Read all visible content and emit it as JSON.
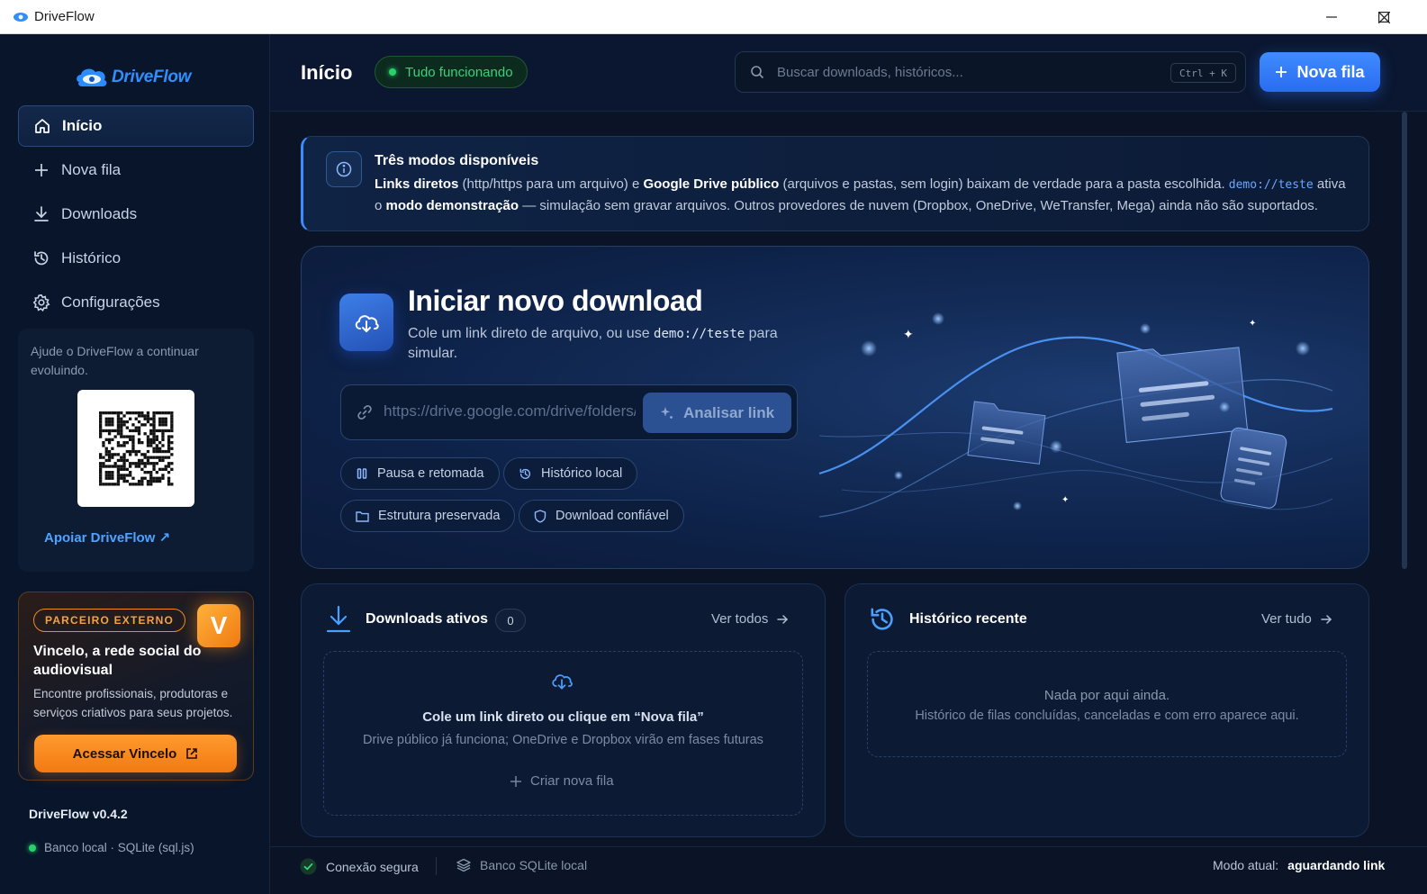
{
  "window": {
    "title": "DriveFlow"
  },
  "sidebar": {
    "logo_text": "DriveFlow",
    "nav": [
      {
        "label": "Início",
        "icon": "home-icon",
        "active": true
      },
      {
        "label": "Nova fila",
        "icon": "plus-icon"
      },
      {
        "label": "Downloads",
        "icon": "download-icon"
      },
      {
        "label": "Histórico",
        "icon": "history-icon"
      },
      {
        "label": "Configurações",
        "icon": "gear-icon"
      }
    ],
    "support": {
      "text": "Ajude o DriveFlow a continuar evoluindo.",
      "link": "Apoiar DriveFlow ↗"
    },
    "partner": {
      "badge": "PARCEIRO EXTERNO",
      "logo_letter": "V",
      "title": "Vincelo, a rede social do audiovisual",
      "description": "Encontre profissionais, produtoras e serviços criativos para seus projetos.",
      "button": "Acessar Vincelo"
    },
    "version": "DriveFlow v0.4.2",
    "db_status": "Banco local · SQLite (sql.js)"
  },
  "header": {
    "title": "Início",
    "status": "Tudo funcionando",
    "search_placeholder": "Buscar downloads, históricos...",
    "shortcut": "Ctrl + K",
    "new_queue": "Nova fila"
  },
  "info": {
    "title": "Três modos disponíveis",
    "p1_bold": "Links diretos",
    "p2": " (http/https para um arquivo) e ",
    "p3_bold": "Google Drive público",
    "p4": " (arquivos e pastas, sem login) baixam de verdade para a pasta escolhida. ",
    "p5_code": "demo://teste",
    "p6": " ativa o ",
    "p7_bold": "modo demonstração",
    "p8": " — simulação sem gravar arquivos. Outros provedores de nuvem (Dropbox, OneDrive, WeTransfer, Mega) ainda não são suportados."
  },
  "hero": {
    "title": "Iniciar novo download",
    "sub_1": "Cole um link direto de arquivo, ou use ",
    "sub_code": "demo://teste",
    "sub_2": " para simular.",
    "url_placeholder": "https://drive.google.com/drive/folders/...",
    "analyze": "Analisar link",
    "chips": [
      "Pausa e retomada",
      "Histórico local",
      "Estrutura preservada",
      "Download confiável"
    ]
  },
  "active_downloads": {
    "title": "Downloads ativos",
    "count": "0",
    "see_all": "Ver todos",
    "empty_main": "Cole um link direto ou clique em “Nova fila”",
    "empty_sub": "Drive público já funciona; OneDrive e Dropbox virão em fases futuras",
    "create": "Criar nova fila"
  },
  "recent_history": {
    "title": "Histórico recente",
    "see_all": "Ver tudo",
    "empty_main": "Nada por aqui ainda.",
    "empty_sub": "Histórico de filas concluídas, canceladas e com erro aparece aqui."
  },
  "statusbar": {
    "secure": "Conexão segura",
    "db": "Banco SQLite local",
    "mode_label": "Modo atual:",
    "mode_value": "aguardando link"
  },
  "colors": {
    "accent": "#3b8cff",
    "success": "#27d16b",
    "partner": "#f28a1c"
  }
}
